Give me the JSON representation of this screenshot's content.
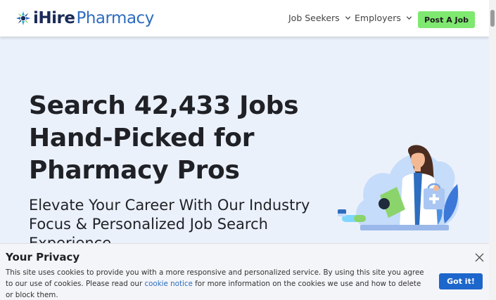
{
  "header": {
    "logo": {
      "brand": "iHire",
      "product": "Pharmacy"
    },
    "nav": [
      {
        "label": "Job Seekers"
      },
      {
        "label": "Employers"
      }
    ],
    "post_job_label": "Post A Job"
  },
  "hero": {
    "title_line1": "Search 42,433 Jobs",
    "title_line2": "Hand-Picked for",
    "title_line3": "Pharmacy Pros",
    "subtitle_line1": "Elevate Your Career With Our Industry",
    "subtitle_line2": "Focus & Personalized Job Search",
    "subtitle_line3": "Experience"
  },
  "cookie_banner": {
    "title": "Your Privacy",
    "text_before_link": "This site uses cookies to provide you with a more responsive and personalized service. By using this site you agree to our use of cookies. Please read our ",
    "link_text": "cookie notice",
    "text_after_link": " for more information on the cookies we use and how to delete or block them.",
    "accept_label": "Got it!"
  },
  "colors": {
    "brand_navy": "#1a2a57",
    "brand_blue": "#2e6dbf",
    "post_button_green": "#7fe870",
    "hero_background": "#ebf1fb",
    "accept_button_blue": "#1c66cc"
  },
  "icons": {
    "logo": "ihire-logo-mark-icon",
    "nav_chevron": "chevron-down-icon",
    "close": "close-icon"
  }
}
